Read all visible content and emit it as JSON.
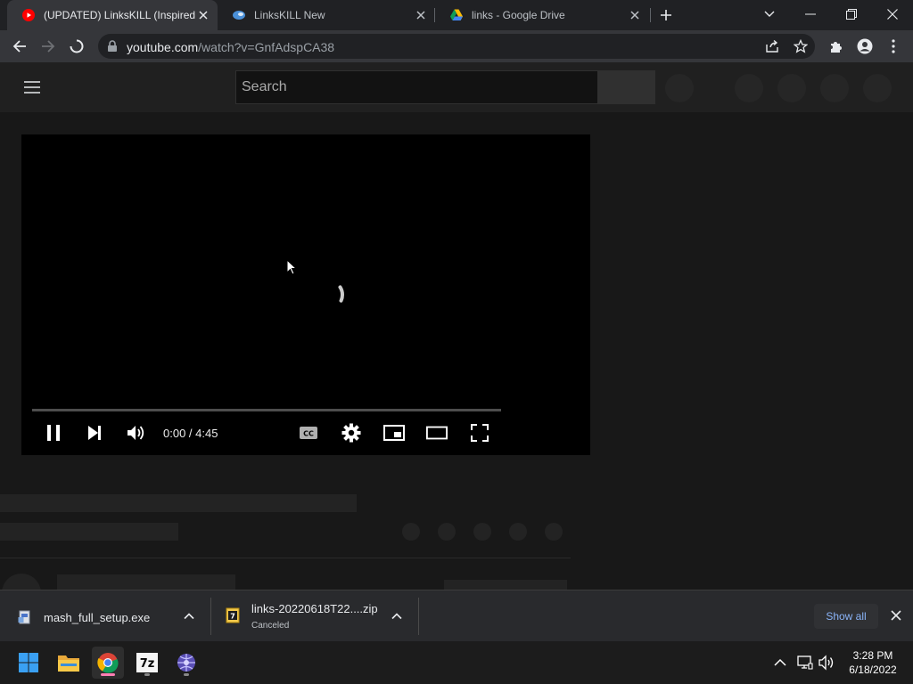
{
  "browser": {
    "tabs": [
      {
        "title": "(UPDATED) LinksKILL (Inspired By",
        "active": true,
        "favicon": "youtube-icon"
      },
      {
        "title": "LinksKILL New",
        "active": false,
        "favicon": "bird-icon"
      },
      {
        "title": "links - Google Drive",
        "active": false,
        "favicon": "google-drive-icon"
      }
    ],
    "url_host": "youtube.com",
    "url_path": "/watch?v=GnfAdspCA38"
  },
  "youtube": {
    "search_placeholder": "Search",
    "player": {
      "time": "0:00 / 4:45",
      "progress": 0
    }
  },
  "downloads": {
    "items": [
      {
        "name": "mash_full_setup.exe",
        "status": ""
      },
      {
        "name": "links-20220618T22....zip",
        "status": "Canceled"
      }
    ],
    "show_all_label": "Show all"
  },
  "taskbar": {
    "time": "3:28 PM",
    "date": "6/18/2022"
  }
}
